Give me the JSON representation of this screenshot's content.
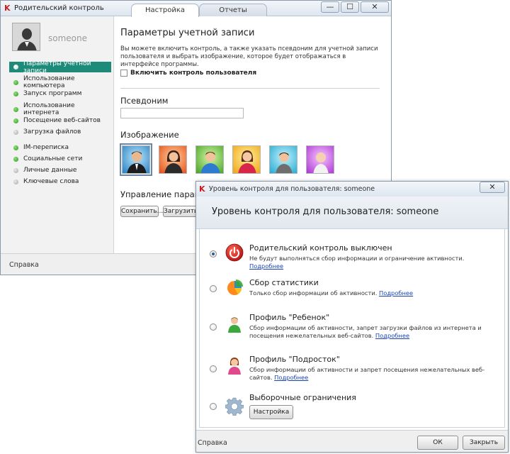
{
  "main_window": {
    "title": "Родительский контроль",
    "tabs": [
      {
        "label": "Настройка",
        "active": true
      },
      {
        "label": "Отчеты",
        "active": false
      }
    ],
    "controls": {
      "minimize": "—",
      "maximize": "☐",
      "close": "✕"
    },
    "user": {
      "name": "someone"
    },
    "sidebar_items": [
      {
        "label": "Параметры учетной записи",
        "status": "active"
      },
      {
        "label": "Использование компьютера",
        "status": "green"
      },
      {
        "label": "Запуск программ",
        "status": "green"
      },
      {
        "label": "Использование интернета",
        "status": "green"
      },
      {
        "label": "Посещение веб-сайтов",
        "status": "green"
      },
      {
        "label": "Загрузка файлов",
        "status": "gray"
      },
      {
        "label": "IM-переписка",
        "status": "green"
      },
      {
        "label": "Социальные сети",
        "status": "green"
      },
      {
        "label": "Личные данные",
        "status": "gray"
      },
      {
        "label": "Ключевые слова",
        "status": "gray"
      }
    ],
    "content": {
      "title": "Параметры учетной записи",
      "description": "Вы можете включить контроль, а также указать псевдоним для учетной записи пользователя и выбрать изображение, которое будет отображаться в интерфейсе программы.",
      "enable_checkbox_label": "Включить контроль пользователя",
      "enable_checked": false,
      "alias_heading": "Псевдоним",
      "alias_value": "",
      "image_heading": "Изображение",
      "manage_heading": "Управление параметрами",
      "save_button": "Сохранить...",
      "load_button": "Загрузить..."
    },
    "footer_help": "Справка"
  },
  "dialog": {
    "title": "Уровень контроля для пользователя: someone",
    "header": "Уровень контроля для пользователя: someone",
    "close": "✕",
    "options": [
      {
        "title": "Родительский контроль выключен",
        "desc": "Не будут выполняться сбор информации и ограничение активности.",
        "link": "Подробнее",
        "selected": true
      },
      {
        "title": "Сбор статистики",
        "desc": "Только сбор информации об активности.",
        "link": "Подробнее",
        "selected": false
      },
      {
        "title": "Профиль \"Ребенок\"",
        "desc": "Сбор информации об активности, запрет загрузки файлов из интернета и посещения нежелательных веб-сайтов.",
        "link": "Подробнее",
        "selected": false
      },
      {
        "title": "Профиль \"Подросток\"",
        "desc": "Сбор информации об активности и запрет посещения нежелательных веб-сайтов.",
        "link": "Подробнее",
        "selected": false
      },
      {
        "title": "Выборочные ограничения",
        "button": "Настройка",
        "selected": false
      }
    ],
    "footer_help": "Справка",
    "ok_button": "ОК",
    "close_button": "Закрыть"
  },
  "colors": {
    "accent": "#1d8a7a",
    "link": "#1a44b8",
    "power_red": "#d42424"
  },
  "icons": [
    "kaspersky-logo-icon",
    "power-icon",
    "pie-chart-icon",
    "child-profile-icon",
    "teen-profile-icon",
    "gear-icon"
  ]
}
